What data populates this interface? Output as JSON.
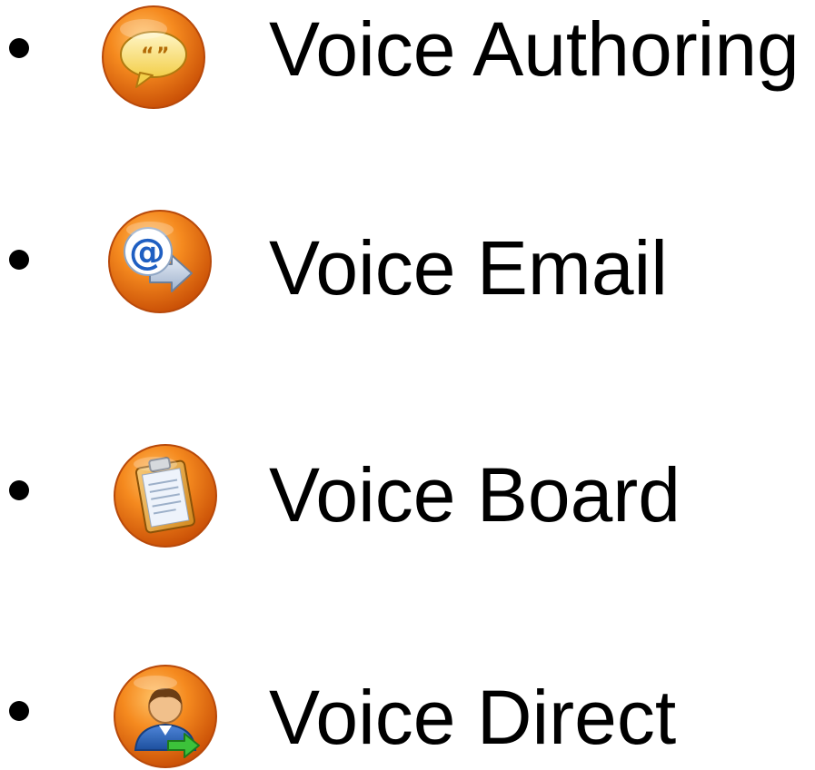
{
  "items": [
    {
      "label": "Voice Authoring",
      "icon": "speech-bubble-quote-icon"
    },
    {
      "label": "Voice Email",
      "icon": "email-at-arrow-icon"
    },
    {
      "label": "Voice Board",
      "icon": "clipboard-icon"
    },
    {
      "label": "Voice Direct",
      "icon": "user-arrow-icon"
    }
  ],
  "colors": {
    "text": "#000000",
    "icon_orange": "#f07a10",
    "icon_orange_dark": "#c4520a",
    "bullet": "#000000"
  }
}
